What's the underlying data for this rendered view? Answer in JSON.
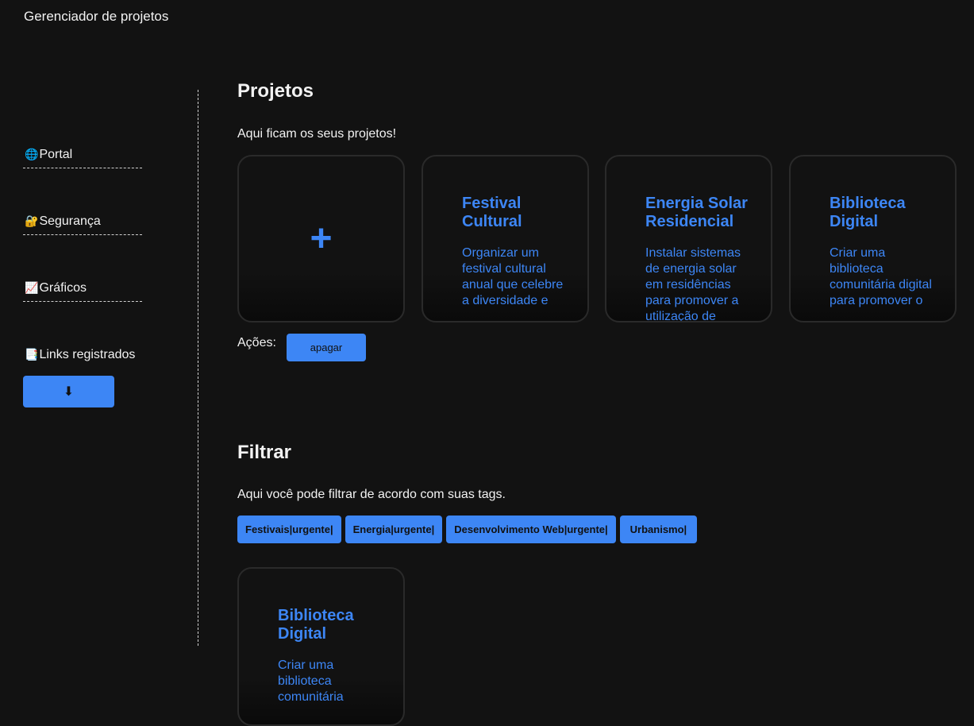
{
  "app": {
    "title": "Gerenciador de projetos"
  },
  "sidebar": {
    "items": [
      {
        "icon": "🌐",
        "label": "Portal"
      },
      {
        "icon": "🔐",
        "label": "Segurança"
      },
      {
        "icon": "📈",
        "label": "Gráficos"
      },
      {
        "icon": "📑",
        "label": "Links registrados"
      }
    ],
    "download_icon": "⬇"
  },
  "projects": {
    "title": "Projetos",
    "description": "Aqui ficam os seus projetos!",
    "add_icon": "+",
    "cards": [
      {
        "title": "Festival Cultural",
        "description": "Organizar um festival cultural anual que celebre a diversidade e"
      },
      {
        "title": "Energia Solar Residencial",
        "description": "Instalar sistemas de energia solar em residências para promover a utilização de"
      },
      {
        "title": "Biblioteca Digital",
        "description": "Criar uma biblioteca comunitária digital para promover o"
      }
    ],
    "actions_label": "Ações:",
    "delete_label": "apagar"
  },
  "filter": {
    "title": "Filtrar",
    "description": "Aqui você pode filtrar de acordo com suas tags.",
    "tags": [
      "Festivais|urgente|",
      "Energia|urgente|",
      "Desenvolvimento Web|urgente|",
      "Urbanismo|"
    ],
    "result_card": {
      "title": "Biblioteca Digital",
      "description": "Criar uma biblioteca comunitária"
    }
  },
  "colors": {
    "accent": "#3d86f5",
    "background": "#121212",
    "card_border": "#2a2a2a"
  }
}
